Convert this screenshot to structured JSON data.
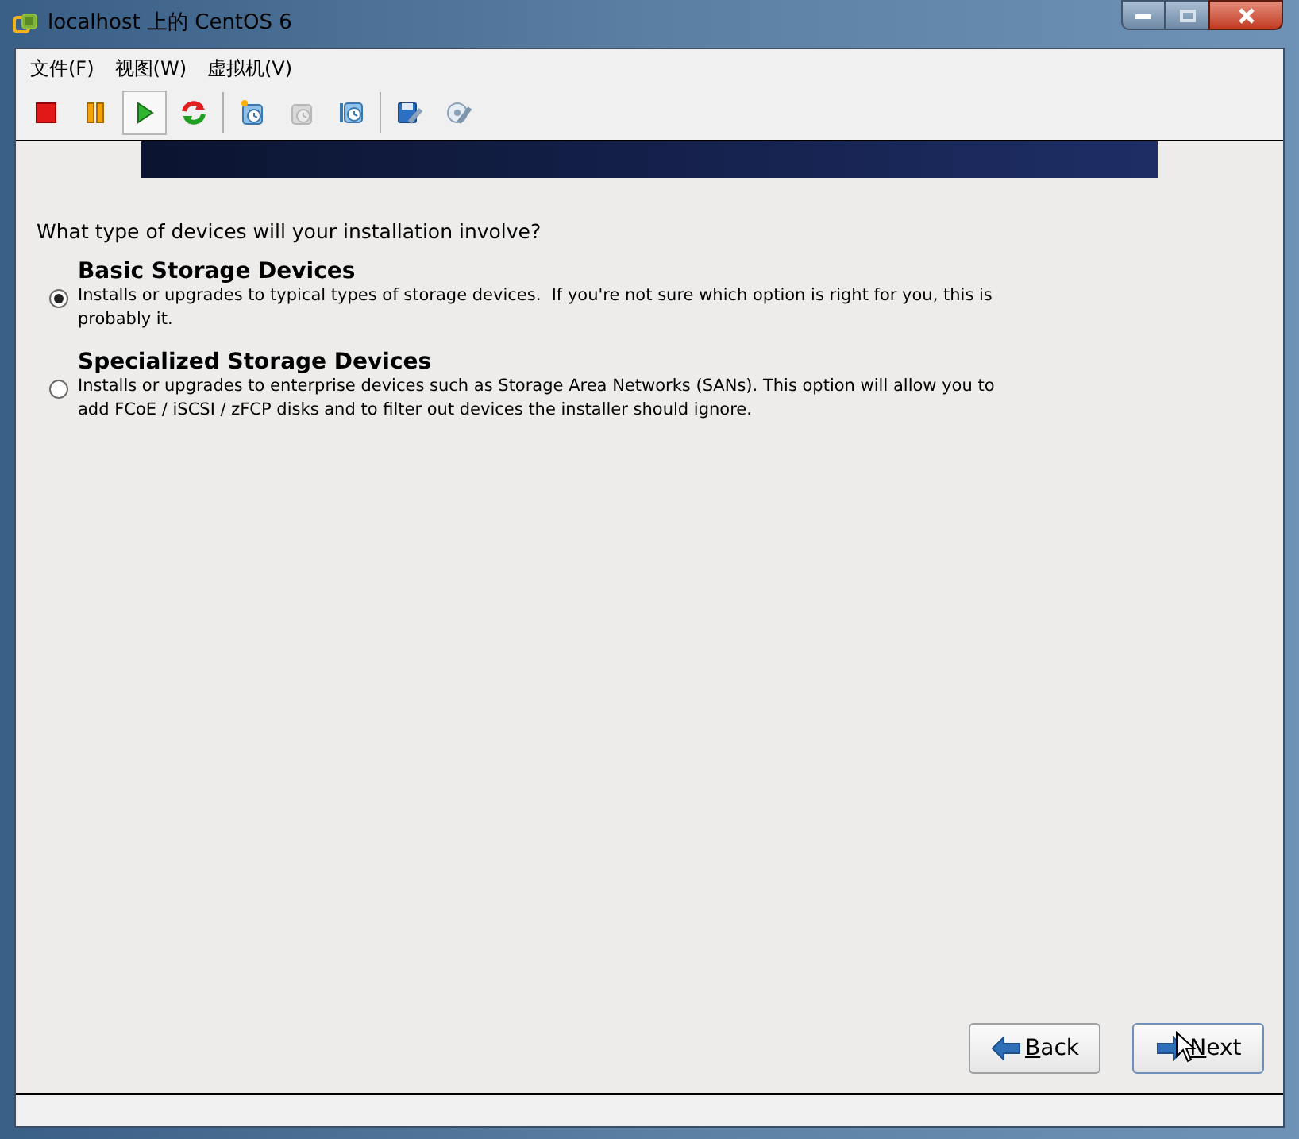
{
  "window": {
    "title": "localhost 上的 CentOS 6"
  },
  "menu": [
    "文件(F)",
    "视图(W)",
    "虚拟机(V)"
  ],
  "toolbar": [
    {
      "kind": "stop",
      "selected": false,
      "disabled": false
    },
    {
      "kind": "pause",
      "selected": false,
      "disabled": false
    },
    {
      "kind": "play",
      "selected": true,
      "disabled": false
    },
    {
      "kind": "reset",
      "selected": false,
      "disabled": false
    },
    {
      "kind": "snapshot",
      "selected": false,
      "disabled": false
    },
    {
      "kind": "revert",
      "selected": false,
      "disabled": true
    },
    {
      "kind": "manager",
      "selected": false,
      "disabled": false
    },
    {
      "kind": "settings",
      "selected": false,
      "disabled": false
    },
    {
      "kind": "disc",
      "selected": false,
      "disabled": false
    }
  ],
  "installer": {
    "question": "What type of devices will your installation involve?",
    "options": [
      {
        "title": "Basic Storage Devices",
        "description": "Installs or upgrades to typical types of storage devices.  If you're not sure which option is right for you, this is probably it.",
        "selected": true
      },
      {
        "title": "Specialized Storage Devices",
        "description": "Installs or upgrades to enterprise devices such as Storage Area Networks (SANs). This option will allow you to add FCoE / iSCSI / zFCP disks and to filter out devices the installer should ignore.",
        "selected": false
      }
    ],
    "buttons": [
      {
        "kind": "back",
        "label": "Back"
      },
      {
        "kind": "next",
        "label": "Next"
      }
    ]
  }
}
